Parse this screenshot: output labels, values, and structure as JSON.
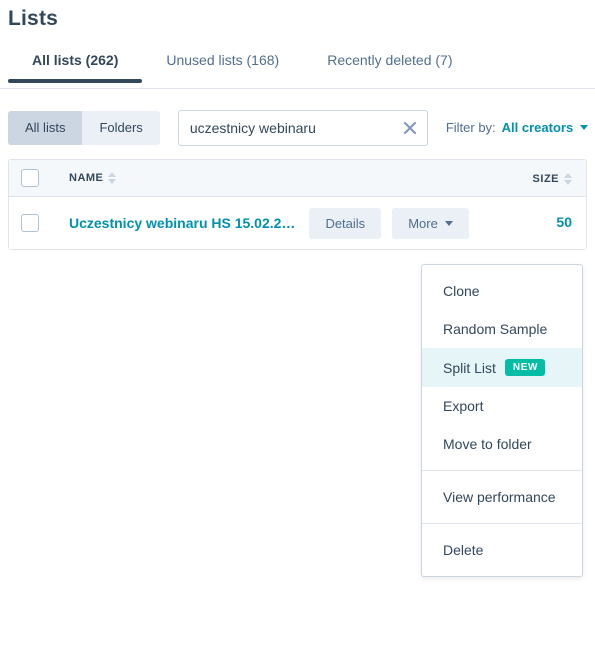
{
  "page": {
    "title": "Lists"
  },
  "tabs": [
    {
      "label": "All lists (262)",
      "active": true
    },
    {
      "label": "Unused lists (168)",
      "active": false
    },
    {
      "label": "Recently deleted (7)",
      "active": false
    }
  ],
  "controls": {
    "segmented": [
      {
        "label": "All lists",
        "selected": true
      },
      {
        "label": "Folders",
        "selected": false
      }
    ],
    "search": {
      "value": "uczestnicy webinaru",
      "placeholder": "Search lists",
      "clear_icon": "close-icon"
    },
    "filter": {
      "label": "Filter by:",
      "value": "All creators",
      "caret_icon": "chevron-down-icon"
    }
  },
  "table": {
    "columns": [
      {
        "label": "NAME",
        "sortable": true
      },
      {
        "label": "SIZE",
        "sortable": true
      }
    ],
    "rows": [
      {
        "name": "Uczestnicy webinaru HS 15.02.2…",
        "details_label": "Details",
        "more_label": "More",
        "size": "50"
      }
    ]
  },
  "dropdown": {
    "items": [
      {
        "label": "Clone",
        "highlighted": false,
        "badge": null,
        "separator_before": false
      },
      {
        "label": "Random Sample",
        "highlighted": false,
        "badge": null,
        "separator_before": false
      },
      {
        "label": "Split List",
        "highlighted": true,
        "badge": "NEW",
        "separator_before": false
      },
      {
        "label": "Export",
        "highlighted": false,
        "badge": null,
        "separator_before": false
      },
      {
        "label": "Move to folder",
        "highlighted": false,
        "badge": null,
        "separator_before": false
      },
      {
        "label": "View performance",
        "highlighted": false,
        "badge": null,
        "separator_before": true
      },
      {
        "label": "Delete",
        "highlighted": false,
        "badge": null,
        "separator_before": true
      }
    ]
  },
  "colors": {
    "accent_teal": "#0091ae",
    "badge_teal": "#00bda5",
    "text_dark": "#33475b",
    "text_muted": "#516f90",
    "border": "#dfe3eb",
    "highlight_row": "#e5f5f8",
    "control_bg": "#eaf0f6",
    "control_selected": "#cbd6e2"
  }
}
